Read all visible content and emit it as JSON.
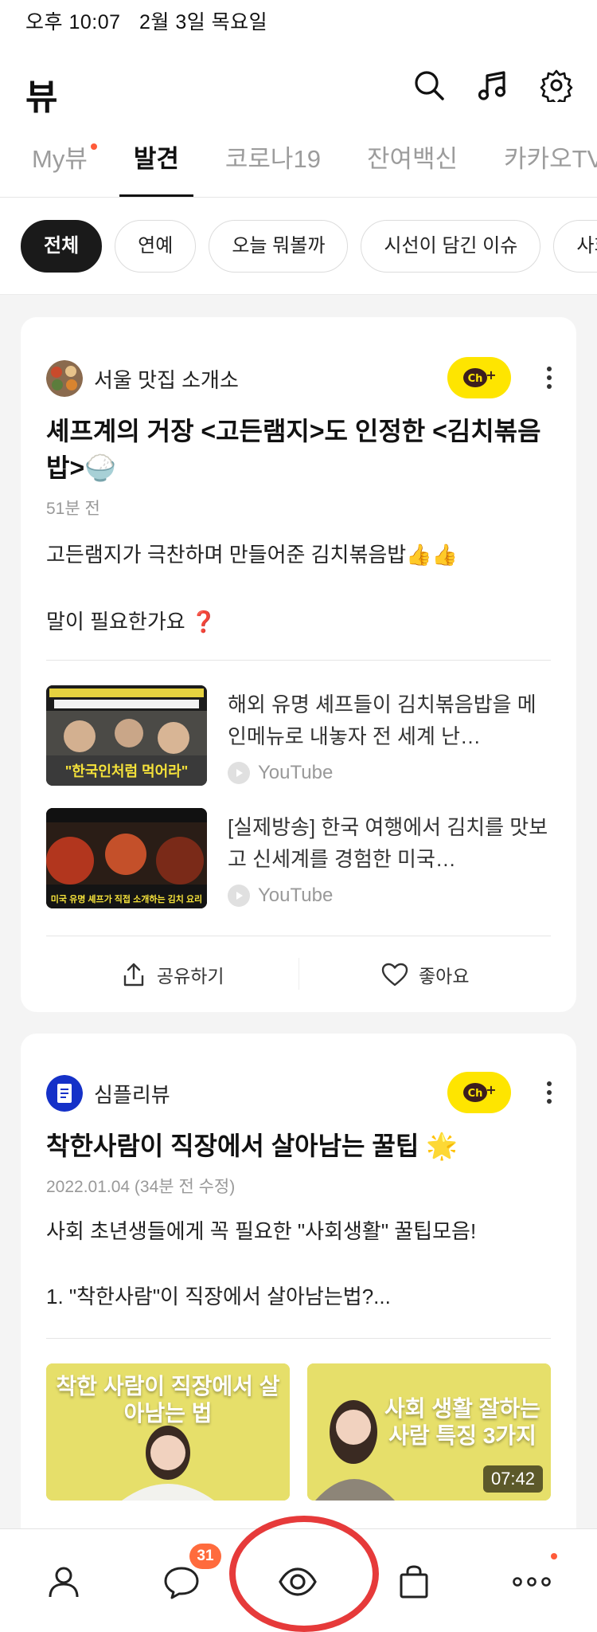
{
  "status": {
    "time": "오후 10:07",
    "date": "2월 3일 목요일"
  },
  "header": {
    "title": "뷰"
  },
  "tabs": [
    {
      "label": "My뷰"
    },
    {
      "label": "발견"
    },
    {
      "label": "코로나19"
    },
    {
      "label": "잔여백신"
    },
    {
      "label": "카카오TV"
    }
  ],
  "chips": [
    {
      "label": "전체"
    },
    {
      "label": "연예"
    },
    {
      "label": "오늘 뭐볼까"
    },
    {
      "label": "시선이 담긴 이슈"
    },
    {
      "label": "사회"
    }
  ],
  "cards": [
    {
      "channel": "서울 맛집 소개소",
      "title": "셰프계의 거장 <고든램지>도 인정한 <김치볶음밥>🍚",
      "time": "51분 전",
      "body_line1": "고든램지가 극찬하며 만들어준 김치볶음밥👍👍",
      "body_line2": "말이 필요한가요 ❓",
      "links": [
        {
          "text": "해외 유명 셰프들이 김치볶음밥을 메인메뉴로 내놓자 전 세계 난…",
          "source": "YouTube",
          "thumb_caption": "\"한국인처럼 먹어라\""
        },
        {
          "text": "[실제방송] 한국 여행에서 김치를 맛보고 신세계를 경험한 미국…",
          "source": "YouTube",
          "thumb_caption": "미국 유명 셰프가 직접 소개하는 김치 요리"
        }
      ],
      "share": "공유하기",
      "like": "좋아요"
    },
    {
      "channel": "심플리뷰",
      "title": "착한사람이 직장에서 살아남는 꿀팁 🌟",
      "time": "2022.01.04 (34분 전 수정)",
      "body_line1": "사회 초년생들에게 꼭 필요한 \"사회생활\" 꿀팁모음!",
      "body_line2": "1. \"착한사람\"이 직장에서 살아남는법?...",
      "images": [
        {
          "caption": "착한 사람이 직장에서 살아남는 법"
        },
        {
          "caption": "사회 생활 잘하는 사람 특징 3가지",
          "duration": "07:42"
        }
      ]
    }
  ],
  "nav": {
    "chat_badge": "31"
  },
  "colors": {
    "accent": "#fee500",
    "badge": "#ff6b3d",
    "annotation": "#e63a3a"
  }
}
